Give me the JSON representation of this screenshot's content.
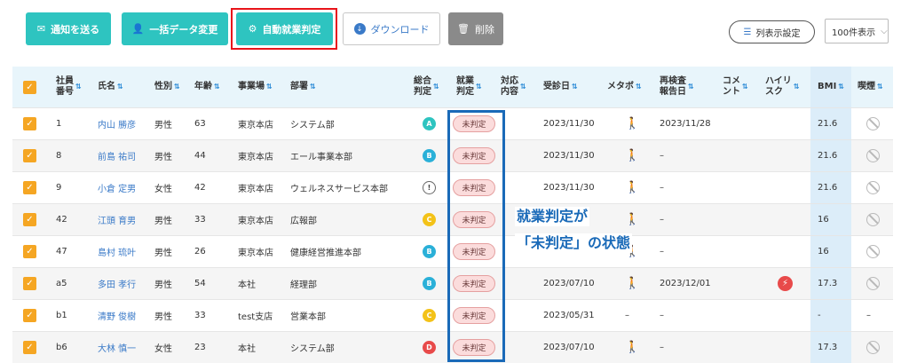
{
  "toolbar": {
    "notify": {
      "label": "通知を送る",
      "icon": "envelope-icon"
    },
    "bulk_edit": {
      "label": "一括データ変更",
      "icon": "user-edit-icon"
    },
    "auto_judge": {
      "label": "自動就業判定",
      "icon": "gears-icon"
    },
    "download": {
      "label": "ダウンロード",
      "icon": "download-circle-icon"
    },
    "delete": {
      "label": "削除",
      "icon": "trash-icon"
    },
    "column_settings": {
      "label": "列表示設定",
      "icon": "list-icon"
    },
    "per_page": {
      "value": "100件表示",
      "icon": "chevron-down-icon"
    }
  },
  "colors": {
    "teal": "#2ec4c0",
    "red_highlight": "#e8141a",
    "blue_annotation": "#1a6ab8",
    "checkbox": "#f5a623"
  },
  "table": {
    "headers": {
      "emp_no": "社員\n番号",
      "name": "氏名",
      "gender": "性別",
      "age": "年齢",
      "office": "事業場",
      "dept": "部署",
      "overall": "総合\n判定",
      "work": "就業\n判定",
      "action": "対応\n内容",
      "exam_date": "受診日",
      "metabo": "メタボ",
      "recheck": "再検査\n報告日",
      "comment": "コメ\nント",
      "high_risk": "ハイリ\nスク",
      "bmi": "BMI",
      "smoking": "喫煙"
    },
    "rows": [
      {
        "emp_no": "1",
        "name": "内山 勝彦",
        "gender": "男性",
        "age": "63",
        "office": "東京本店",
        "dept": "システム部",
        "overall": "A",
        "work": "未判定",
        "exam_date": "2023/11/30",
        "recheck": "2023/11/28",
        "high_risk": "",
        "bmi": "21.6",
        "smoking": "no-smoking-icon",
        "metabo": "person-icon"
      },
      {
        "emp_no": "8",
        "name": "前島 祐司",
        "gender": "男性",
        "age": "44",
        "office": "東京本店",
        "dept": "エール事業本部",
        "overall": "B",
        "work": "未判定",
        "exam_date": "2023/11/30",
        "recheck": "–",
        "high_risk": "",
        "bmi": "21.6",
        "smoking": "no-smoking-icon",
        "metabo": "person-icon"
      },
      {
        "emp_no": "9",
        "name": "小倉 定男",
        "gender": "女性",
        "age": "42",
        "office": "東京本店",
        "dept": "ウェルネスサービス本部",
        "overall": "!",
        "work": "未判定",
        "exam_date": "2023/11/30",
        "recheck": "–",
        "high_risk": "",
        "bmi": "21.6",
        "smoking": "no-smoking-icon",
        "metabo": "person-icon"
      },
      {
        "emp_no": "42",
        "name": "江頭 育男",
        "gender": "男性",
        "age": "33",
        "office": "東京本店",
        "dept": "広報部",
        "overall": "C",
        "work": "未判定",
        "exam_date": "",
        "recheck": "–",
        "high_risk": "",
        "bmi": "16",
        "smoking": "no-smoking-icon",
        "metabo": "person-icon"
      },
      {
        "emp_no": "47",
        "name": "島村 琉叶",
        "gender": "男性",
        "age": "26",
        "office": "東京本店",
        "dept": "健康経営推進本部",
        "overall": "B",
        "work": "未判定",
        "exam_date": "",
        "recheck": "–",
        "high_risk": "",
        "bmi": "16",
        "smoking": "no-smoking-icon",
        "metabo": "person-icon"
      },
      {
        "emp_no": "a5",
        "name": "多田 孝行",
        "gender": "男性",
        "age": "54",
        "office": "本社",
        "dept": "経理部",
        "overall": "B",
        "work": "未判定",
        "exam_date": "2023/07/10",
        "recheck": "2023/12/01",
        "high_risk": "bolt-icon",
        "bmi": "17.3",
        "smoking": "no-smoking-icon",
        "metabo": "person-icon"
      },
      {
        "emp_no": "b1",
        "name": "清野 俊樹",
        "gender": "男性",
        "age": "33",
        "office": "test支店",
        "dept": "営業本部",
        "overall": "C",
        "work": "未判定",
        "exam_date": "2023/05/31",
        "recheck": "–",
        "high_risk": "",
        "bmi": "-",
        "smoking": "–",
        "metabo": "–"
      },
      {
        "emp_no": "b6",
        "name": "大林 慎一",
        "gender": "女性",
        "age": "23",
        "office": "本社",
        "dept": "システム部",
        "overall": "D",
        "work": "未判定",
        "exam_date": "2023/07/10",
        "recheck": "–",
        "high_risk": "",
        "bmi": "17.3",
        "smoking": "no-smoking-icon",
        "metabo": "person-icon"
      }
    ]
  },
  "annotation": {
    "line1": "就業判定が",
    "line2": "「未判定」の状態"
  }
}
